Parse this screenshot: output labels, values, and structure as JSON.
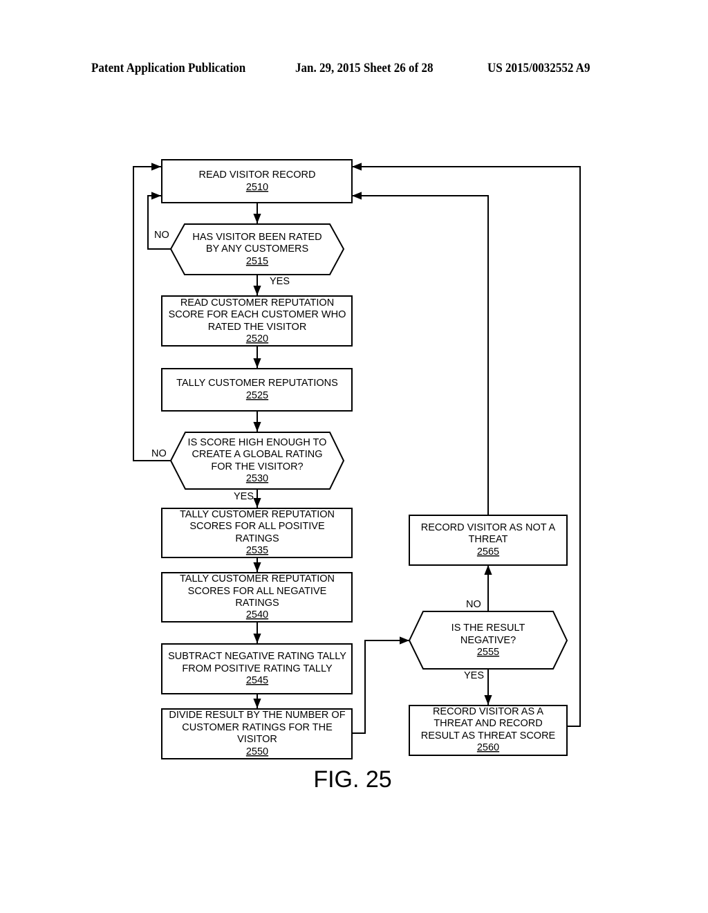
{
  "header": {
    "publication": "Patent Application Publication",
    "date_sheet": "Jan. 29, 2015  Sheet 26 of 28",
    "number": "US 2015/0032552 A9"
  },
  "figure_label": "FIG. 25",
  "nodes": {
    "n2510": {
      "type": "process",
      "lines": [
        "READ VISITOR RECORD"
      ],
      "ref": "2510"
    },
    "n2515": {
      "type": "decision",
      "lines": [
        "HAS VISITOR BEEN RATED",
        "BY ANY CUSTOMERS"
      ],
      "ref": "2515"
    },
    "n2520": {
      "type": "process",
      "lines": [
        "READ CUSTOMER REPUTATION",
        "SCORE FOR EACH CUSTOMER WHO",
        "RATED THE VISITOR"
      ],
      "ref": "2520"
    },
    "n2525": {
      "type": "process",
      "lines": [
        "TALLY CUSTOMER REPUTATIONS"
      ],
      "ref": "2525"
    },
    "n2530": {
      "type": "decision",
      "lines": [
        "IS SCORE HIGH ENOUGH TO",
        "CREATE A GLOBAL RATING",
        "FOR THE VISITOR?"
      ],
      "ref": "2530"
    },
    "n2535": {
      "type": "process",
      "lines": [
        "TALLY CUSTOMER REPUTATION",
        "SCORES FOR ALL POSITIVE",
        "RATINGS"
      ],
      "ref": "2535"
    },
    "n2540": {
      "type": "process",
      "lines": [
        "TALLY CUSTOMER REPUTATION",
        "SCORES FOR ALL NEGATIVE",
        "RATINGS"
      ],
      "ref": "2540"
    },
    "n2545": {
      "type": "process",
      "lines": [
        "SUBTRACT NEGATIVE RATING TALLY",
        "FROM POSITIVE RATING TALLY"
      ],
      "ref": "2545"
    },
    "n2550": {
      "type": "process",
      "lines": [
        "DIVIDE RESULT BY THE NUMBER OF",
        "CUSTOMER RATINGS FOR THE",
        "VISITOR"
      ],
      "ref": "2550"
    },
    "n2555": {
      "type": "decision",
      "lines": [
        "IS THE RESULT",
        "NEGATIVE?"
      ],
      "ref": "2555"
    },
    "n2560": {
      "type": "process",
      "lines": [
        "RECORD VISITOR AS A",
        "THREAT AND RECORD",
        "RESULT AS THREAT SCORE"
      ],
      "ref": "2560"
    },
    "n2565": {
      "type": "process",
      "lines": [
        "RECORD VISITOR AS NOT A",
        "THREAT"
      ],
      "ref": "2565"
    }
  },
  "edge_labels": {
    "d2515_no": "NO",
    "d2515_yes": "YES",
    "d2530_no": "NO",
    "d2530_yes": "YES",
    "d2555_no": "NO",
    "d2555_yes": "YES"
  }
}
